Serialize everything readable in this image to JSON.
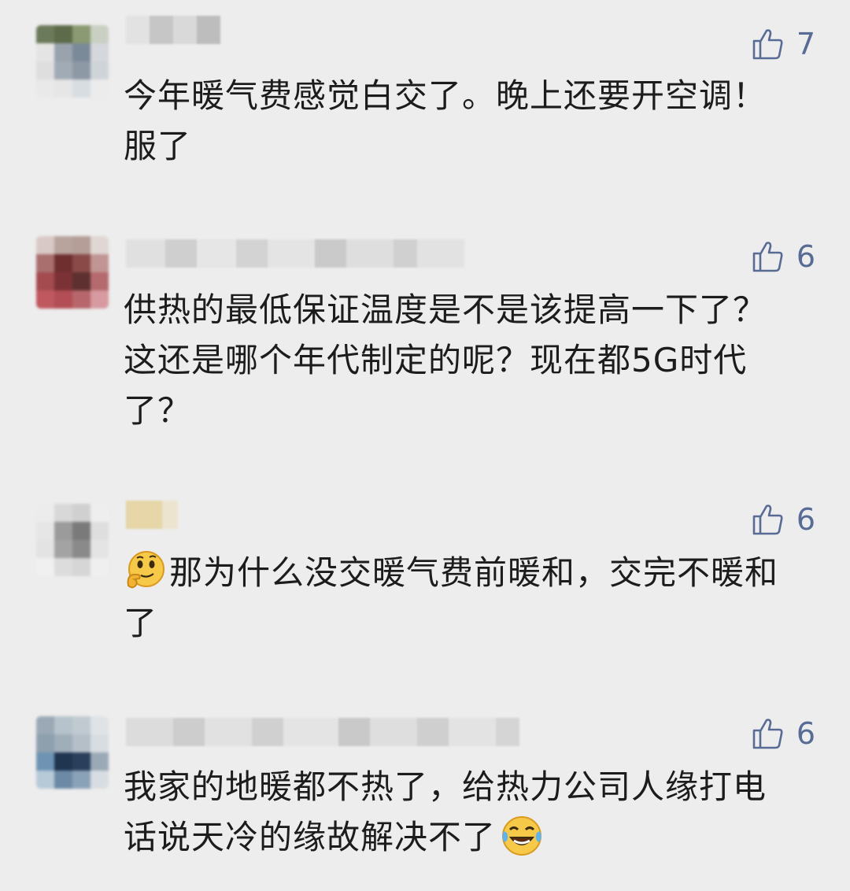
{
  "comments": [
    {
      "likes": "7",
      "text": "今年暖气费感觉白交了。晚上还要开空调！服了"
    },
    {
      "likes": "6",
      "text": "供热的最低保证温度是不是该提高一下了？这还是哪个年代制定的呢？现在都5G时代了？"
    },
    {
      "likes": "6",
      "emoji_before": "thinking-face-emoji",
      "text": "那为什么没交暖气费前暖和，交完不暖和了"
    },
    {
      "likes": "6",
      "emoji_after": "crying-laughing-emoji",
      "text": "我家的地暖都不热了，给热力公司人缘打电话说天冷的缘故解决不了"
    }
  ],
  "colors": {
    "background": "#ededed",
    "like_accent": "#576b95",
    "text": "#1c1c1c"
  },
  "icons": {
    "like": "thumbs-up-icon"
  }
}
